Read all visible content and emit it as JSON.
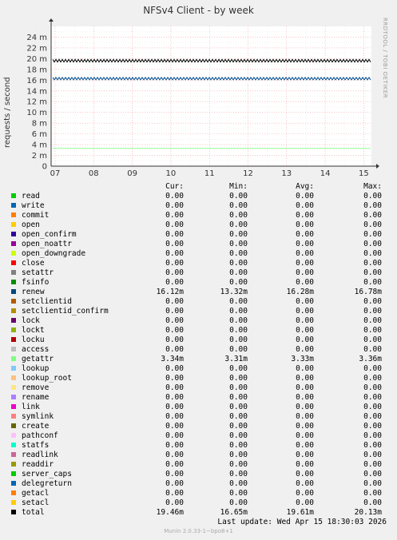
{
  "title": "NFSv4 Client - by week",
  "side_label": "RRDTOOL / TOBI OETIKER",
  "chart_data": {
    "type": "line",
    "title": "NFSv4 Client - by week",
    "ylabel": "requests / second",
    "x_ticks": [
      "07",
      "08",
      "09",
      "10",
      "11",
      "12",
      "13",
      "14",
      "15"
    ],
    "y_ticks": [
      "0",
      "2 m",
      "4 m",
      "6 m",
      "8 m",
      "10 m",
      "12 m",
      "14 m",
      "16 m",
      "18 m",
      "20 m",
      "22 m",
      "24 m"
    ],
    "ylim": [
      0,
      0.026
    ],
    "grid": true,
    "series": [
      {
        "name": "total",
        "color": "#000000",
        "level": 0.01961,
        "amplitude": 0.00025
      },
      {
        "name": "renew",
        "color": "#00488c",
        "level": 0.01628,
        "amplitude": 0.00022
      },
      {
        "name": "getattr",
        "color": "#99ff99",
        "level": 0.00333,
        "amplitude": 2e-05
      }
    ]
  },
  "legend": {
    "headers": {
      "cur": "Cur:",
      "min": "Min:",
      "avg": "Avg:",
      "max": "Max:"
    },
    "rows": [
      {
        "name": "read",
        "color": "#00cc00",
        "cur": "0.00",
        "min": "0.00",
        "avg": "0.00",
        "max": "0.00"
      },
      {
        "name": "write",
        "color": "#0066b3",
        "cur": "0.00",
        "min": "0.00",
        "avg": "0.00",
        "max": "0.00"
      },
      {
        "name": "commit",
        "color": "#ff8000",
        "cur": "0.00",
        "min": "0.00",
        "avg": "0.00",
        "max": "0.00"
      },
      {
        "name": "open",
        "color": "#ffcc00",
        "cur": "0.00",
        "min": "0.00",
        "avg": "0.00",
        "max": "0.00"
      },
      {
        "name": "open_confirm",
        "color": "#330099",
        "cur": "0.00",
        "min": "0.00",
        "avg": "0.00",
        "max": "0.00"
      },
      {
        "name": "open_noattr",
        "color": "#990099",
        "cur": "0.00",
        "min": "0.00",
        "avg": "0.00",
        "max": "0.00"
      },
      {
        "name": "open_downgrade",
        "color": "#ccff00",
        "cur": "0.00",
        "min": "0.00",
        "avg": "0.00",
        "max": "0.00"
      },
      {
        "name": "close",
        "color": "#ff0000",
        "cur": "0.00",
        "min": "0.00",
        "avg": "0.00",
        "max": "0.00"
      },
      {
        "name": "setattr",
        "color": "#808080",
        "cur": "0.00",
        "min": "0.00",
        "avg": "0.00",
        "max": "0.00"
      },
      {
        "name": "fsinfo",
        "color": "#008f00",
        "cur": "0.00",
        "min": "0.00",
        "avg": "0.00",
        "max": "0.00"
      },
      {
        "name": "renew",
        "color": "#00487d",
        "cur": "16.12m",
        "min": "13.32m",
        "avg": "16.28m",
        "max": "16.78m"
      },
      {
        "name": "setclientid",
        "color": "#b35a00",
        "cur": "0.00",
        "min": "0.00",
        "avg": "0.00",
        "max": "0.00"
      },
      {
        "name": "setclientid_confirm",
        "color": "#b38f00",
        "cur": "0.00",
        "min": "0.00",
        "avg": "0.00",
        "max": "0.00"
      },
      {
        "name": "lock",
        "color": "#6b006b",
        "cur": "0.00",
        "min": "0.00",
        "avg": "0.00",
        "max": "0.00"
      },
      {
        "name": "lockt",
        "color": "#8fb300",
        "cur": "0.00",
        "min": "0.00",
        "avg": "0.00",
        "max": "0.00"
      },
      {
        "name": "locku",
        "color": "#b30000",
        "cur": "0.00",
        "min": "0.00",
        "avg": "0.00",
        "max": "0.00"
      },
      {
        "name": "access",
        "color": "#bebebe",
        "cur": "0.00",
        "min": "0.00",
        "avg": "0.00",
        "max": "0.00"
      },
      {
        "name": "getattr",
        "color": "#80ff80",
        "cur": "3.34m",
        "min": "3.31m",
        "avg": "3.33m",
        "max": "3.36m"
      },
      {
        "name": "lookup",
        "color": "#80c9ff",
        "cur": "0.00",
        "min": "0.00",
        "avg": "0.00",
        "max": "0.00"
      },
      {
        "name": "lookup_root",
        "color": "#ffc080",
        "cur": "0.00",
        "min": "0.00",
        "avg": "0.00",
        "max": "0.00"
      },
      {
        "name": "remove",
        "color": "#ffe680",
        "cur": "0.00",
        "min": "0.00",
        "avg": "0.00",
        "max": "0.00"
      },
      {
        "name": "rename",
        "color": "#aa80ff",
        "cur": "0.00",
        "min": "0.00",
        "avg": "0.00",
        "max": "0.00"
      },
      {
        "name": "link",
        "color": "#ee00cc",
        "cur": "0.00",
        "min": "0.00",
        "avg": "0.00",
        "max": "0.00"
      },
      {
        "name": "symlink",
        "color": "#ff8080",
        "cur": "0.00",
        "min": "0.00",
        "avg": "0.00",
        "max": "0.00"
      },
      {
        "name": "create",
        "color": "#666600",
        "cur": "0.00",
        "min": "0.00",
        "avg": "0.00",
        "max": "0.00"
      },
      {
        "name": "pathconf",
        "color": "#ffbfff",
        "cur": "0.00",
        "min": "0.00",
        "avg": "0.00",
        "max": "0.00"
      },
      {
        "name": "statfs",
        "color": "#00ffcc",
        "cur": "0.00",
        "min": "0.00",
        "avg": "0.00",
        "max": "0.00"
      },
      {
        "name": "readlink",
        "color": "#cc6699",
        "cur": "0.00",
        "min": "0.00",
        "avg": "0.00",
        "max": "0.00"
      },
      {
        "name": "readdir",
        "color": "#999900",
        "cur": "0.00",
        "min": "0.00",
        "avg": "0.00",
        "max": "0.00"
      },
      {
        "name": "server_caps",
        "color": "#00cc00",
        "cur": "0.00",
        "min": "0.00",
        "avg": "0.00",
        "max": "0.00"
      },
      {
        "name": "delegreturn",
        "color": "#0066b3",
        "cur": "0.00",
        "min": "0.00",
        "avg": "0.00",
        "max": "0.00"
      },
      {
        "name": "getacl",
        "color": "#ff8000",
        "cur": "0.00",
        "min": "0.00",
        "avg": "0.00",
        "max": "0.00"
      },
      {
        "name": "setacl",
        "color": "#ffcc00",
        "cur": "0.00",
        "min": "0.00",
        "avg": "0.00",
        "max": "0.00"
      },
      {
        "name": "total",
        "color": "#000000",
        "cur": "19.46m",
        "min": "16.65m",
        "avg": "19.61m",
        "max": "20.13m"
      }
    ]
  },
  "last_update": "Last update: Wed Apr 15 18:30:03 2026",
  "footer": "Munin 2.0.33-1~bpo8+1"
}
